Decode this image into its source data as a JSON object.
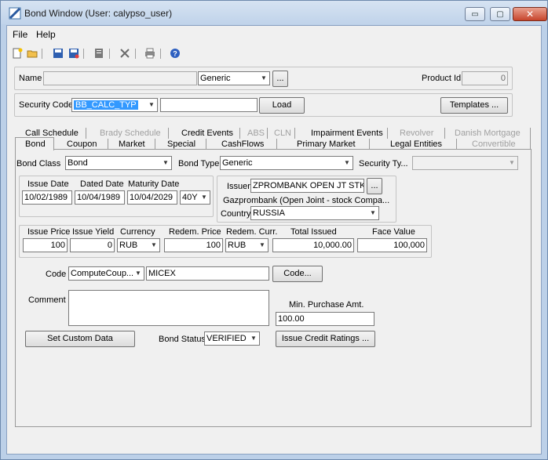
{
  "window": {
    "title": "Bond Window (User: calypso_user)",
    "controls": {
      "minimize": "▭",
      "maximize": "▢",
      "close": "✕"
    }
  },
  "menu": {
    "items": [
      "File",
      "Help"
    ]
  },
  "toolbar": {
    "icons": [
      "new-icon",
      "open-icon",
      "save-icon",
      "save-as-icon",
      "notes-icon",
      "delete-icon",
      "print-icon",
      "help-icon"
    ]
  },
  "header": {
    "name_label": "Name",
    "name_value": "",
    "name_type": "Generic",
    "name_more": "...",
    "product_id_label": "Product Id",
    "product_id_value": "0"
  },
  "security": {
    "label": "Security Code",
    "code_value": "BB_CALC_TYP",
    "text_value": "",
    "load_label": "Load",
    "templates_label": "Templates ..."
  },
  "tabs": {
    "row1": [
      {
        "label": "Call Schedule",
        "enabled": true
      },
      {
        "label": "Brady Schedule",
        "enabled": false
      },
      {
        "label": "Credit Events",
        "enabled": true
      },
      {
        "label": "ABS",
        "enabled": false
      },
      {
        "label": "CLN",
        "enabled": false
      },
      {
        "label": "Impairment Events",
        "enabled": true
      },
      {
        "label": "Revolver",
        "enabled": false
      },
      {
        "label": "Danish Mortgage",
        "enabled": false
      }
    ],
    "row2": [
      {
        "label": "Bond",
        "enabled": true
      },
      {
        "label": "Coupon",
        "enabled": true
      },
      {
        "label": "Market",
        "enabled": true
      },
      {
        "label": "Special",
        "enabled": true
      },
      {
        "label": "CashFlows",
        "enabled": true
      },
      {
        "label": "Primary Market",
        "enabled": true
      },
      {
        "label": "Legal Entities",
        "enabled": true
      },
      {
        "label": "Convertible",
        "enabled": false
      }
    ]
  },
  "bond": {
    "bond_class_label": "Bond Class",
    "bond_class_value": "Bond",
    "bond_type_label": "Bond Type",
    "bond_type_value": "Generic",
    "security_type_label": "Security Ty...",
    "security_type_value": "",
    "issue_date_label": "Issue Date",
    "issue_date_value": "10/02/1989",
    "dated_date_label": "Dated Date",
    "dated_date_value": "10/04/1989",
    "maturity_date_label": "Maturity Date",
    "maturity_date_value": "10/04/2029",
    "tenor_value": "40Y",
    "issuer_label": "Issuer",
    "issuer_value": "ZPROMBANK OPEN JT STK CO",
    "issuer_more": "...",
    "issuer_fullname": "Gazprombank (Open Joint - stock Compa...",
    "country_label": "Country",
    "country_value": "RUSSIA",
    "issue_price_label": "Issue Price",
    "issue_price_value": "100",
    "issue_yield_label": "Issue Yield",
    "issue_yield_value": "0",
    "currency_label": "Currency",
    "currency_value": "RUB",
    "redem_price_label": "Redem. Price",
    "redem_price_value": "100",
    "redem_curr_label": "Redem. Curr.",
    "redem_curr_value": "RUB",
    "total_issued_label": "Total Issued",
    "total_issued_value": "10,000.00",
    "face_value_label": "Face Value",
    "face_value_value": "100,000",
    "code_label": "Code",
    "code_type_value": "ComputeCoup...",
    "code_value": "MICEX",
    "code_button": "Code...",
    "comment_label": "Comment",
    "comment_value": "",
    "min_purchase_label": "Min. Purchase Amt.",
    "min_purchase_value": "100.00",
    "set_custom_data_label": "Set Custom Data",
    "bond_status_label": "Bond Status",
    "bond_status_value": "VERIFIED",
    "issue_credit_ratings_label": "Issue Credit Ratings ..."
  }
}
